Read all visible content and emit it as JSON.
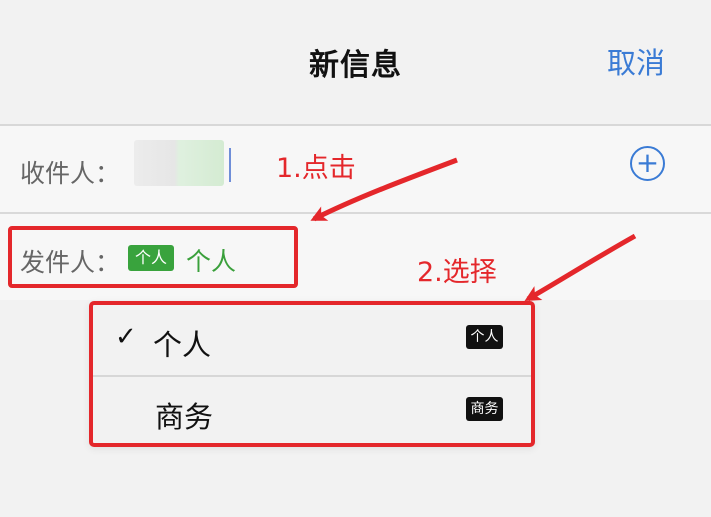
{
  "header": {
    "title": "新信息",
    "cancel_label": "取消"
  },
  "form": {
    "recipient": {
      "label": "收件人："
    },
    "sender": {
      "label": "发件人：",
      "badge": "个人",
      "value": "个人"
    }
  },
  "annotations": {
    "step_1": "1.点击",
    "step_2": "2.选择"
  },
  "menu": {
    "items": [
      {
        "label": "个人",
        "tag": "个人",
        "selected": true
      },
      {
        "label": "商务",
        "tag": "商务",
        "selected": false
      }
    ]
  },
  "colors": {
    "accent": "#3a7bd5",
    "annotation": "#e4272b",
    "sender": "#39a33d"
  },
  "icons": {
    "add": "plus-circle-icon",
    "check": "check-icon"
  }
}
